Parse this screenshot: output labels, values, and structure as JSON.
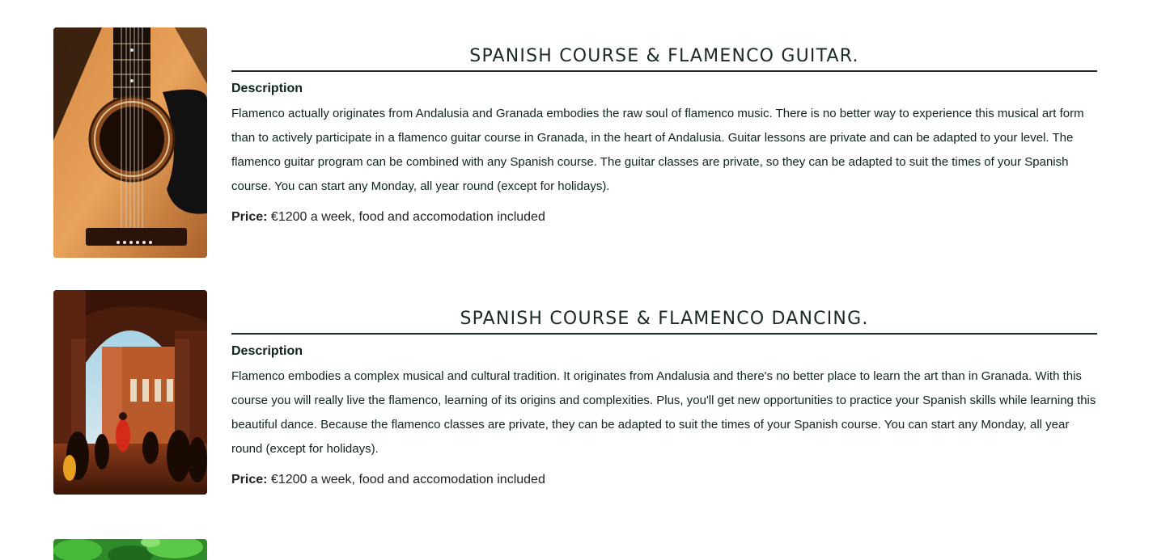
{
  "courses": [
    {
      "title": "SPANISH COURSE & FLAMENCO GUITAR.",
      "description_label": "Description",
      "description": "Flamenco actually originates from Andalusia and Granada embodies the raw soul of flamenco music. There is no better way to experience this musical art form than to actively participate in a flamenco guitar course in Granada, in the heart of Andalusia. Guitar lessons are private and can be adapted to your level. The flamenco guitar program can be combined with any Spanish course. The guitar classes are private, so they can be adapted to suit the times of your Spanish course. You can start any Monday, all year round (except for holidays).",
      "price_label": "Price:",
      "price_text": "€1200 a week, food and accomodation included",
      "image": "acoustic-guitar-photo"
    },
    {
      "title": "SPANISH COURSE & FLAMENCO DANCING.",
      "description_label": "Description",
      "description": "Flamenco embodies a complex musical and cultural tradition. It originates from Andalusia and there's no better place to learn the art than in Granada. With this course you will really live the flamenco, learning of its origins and complexities. Plus, you'll get new opportunities to practice your Spanish skills while learning this beautiful dance. Because the flamenco classes are private, they can be adapted to suit the times of your Spanish course. You can start any Monday, all year round (except for holidays).",
      "price_label": "Price:",
      "price_text": "€1200 a week, food and accomodation included",
      "image": "plaza-arches-photo"
    },
    {
      "image": "green-foliage-photo"
    }
  ]
}
